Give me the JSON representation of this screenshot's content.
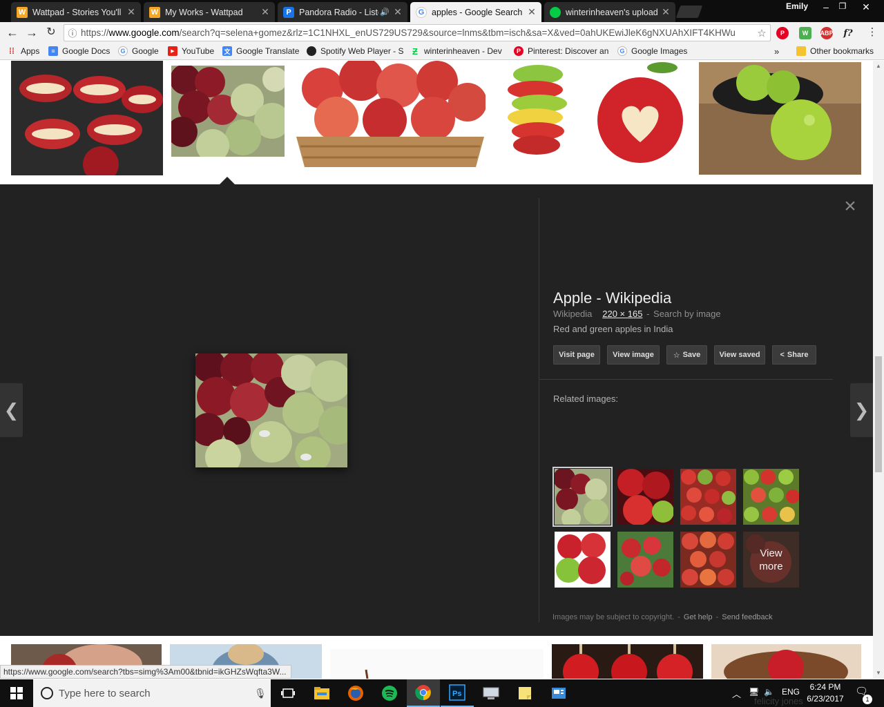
{
  "tabs": [
    {
      "label": "Wattpad - Stories You'll L",
      "icon": "wattpad-icon"
    },
    {
      "label": "My Works - Wattpad",
      "icon": "wattpad-icon"
    },
    {
      "label": "Pandora Radio - Listen",
      "icon": "pandora-icon"
    },
    {
      "label": "apples - Google Search",
      "icon": "google-icon"
    },
    {
      "label": "winterinheaven's uploads",
      "icon": "deviantart-icon"
    }
  ],
  "window": {
    "profile": "Emily"
  },
  "toolbar": {
    "url_scheme": "https://",
    "url_host": "www.google.com",
    "url_path": "/search?q=selena+gomez&rlz=1C1NHXL_enUS729US729&source=lnms&tbm=isch&sa=X&ved=0ahUKEwiJleK6gNXUAhXIFT4KHWu"
  },
  "extensions": {
    "abp": "ABP",
    "fx": "f?"
  },
  "bookmarks": [
    {
      "label": "Apps"
    },
    {
      "label": "Google Docs"
    },
    {
      "label": "Google"
    },
    {
      "label": "YouTube"
    },
    {
      "label": "Google Translate"
    },
    {
      "label": "Spotify Web Player - S"
    },
    {
      "label": "winterinheaven - Dev"
    },
    {
      "label": "Pinterest: Discover an"
    },
    {
      "label": "Google Images"
    },
    {
      "label": "»"
    },
    {
      "label": "Other bookmarks"
    }
  ],
  "viewer": {
    "title": "Apple - Wikipedia",
    "source": "Wikipedia",
    "dimensions": "220 × 165",
    "search_by_image": "Search by image",
    "description": "Red and green apples in India",
    "buttons": {
      "visit_page": "Visit page",
      "view_image": "View image",
      "save": "Save",
      "view_saved": "View saved",
      "share": "Share"
    },
    "related_label": "Related images:",
    "view_more_line1": "View",
    "view_more_line2": "more",
    "footer_notice": "Images may be subject to copyright.",
    "footer_sep": "-",
    "get_help": "Get help",
    "send_feedback": "Send feedback"
  },
  "status_url": "https://www.google.com/search?tbs=simg%3Am00&tbnid=ikGHZsWqfta3W...",
  "taskbar": {
    "search_placeholder": "Type here to search",
    "language": "ENG",
    "time": "6:24 PM",
    "date": "6/23/2017",
    "notification_count": "1"
  },
  "ghost_text": "felicity jones"
}
